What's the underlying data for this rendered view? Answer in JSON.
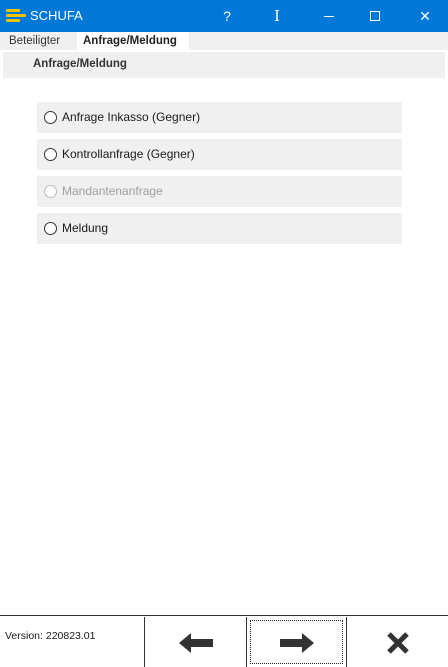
{
  "window": {
    "title": "SCHUFA",
    "help_glyph": "?",
    "cursor_glyph": "I",
    "close_glyph": "✕"
  },
  "tabs": [
    {
      "label": "Beteiligter"
    },
    {
      "label": "Anfrage/Meldung"
    }
  ],
  "section": {
    "title": "Anfrage/Meldung"
  },
  "options": [
    {
      "label": "Anfrage Inkasso (Gegner)",
      "enabled": true
    },
    {
      "label": "Kontrollanfrage (Gegner)",
      "enabled": true
    },
    {
      "label": "Mandantenanfrage",
      "enabled": false
    },
    {
      "label": "Meldung",
      "enabled": true
    }
  ],
  "footer": {
    "version": "Version: 220823.01"
  },
  "icons": {
    "app": "schufa-logo-icon",
    "back": "arrow-left-icon",
    "next": "arrow-right-icon",
    "cancel": "x-icon"
  },
  "colors": {
    "titlebar": "#0078d7",
    "logo": "#f2c300",
    "option_bg": "#f0f0f0",
    "disabled_text": "#a0a0a0"
  }
}
